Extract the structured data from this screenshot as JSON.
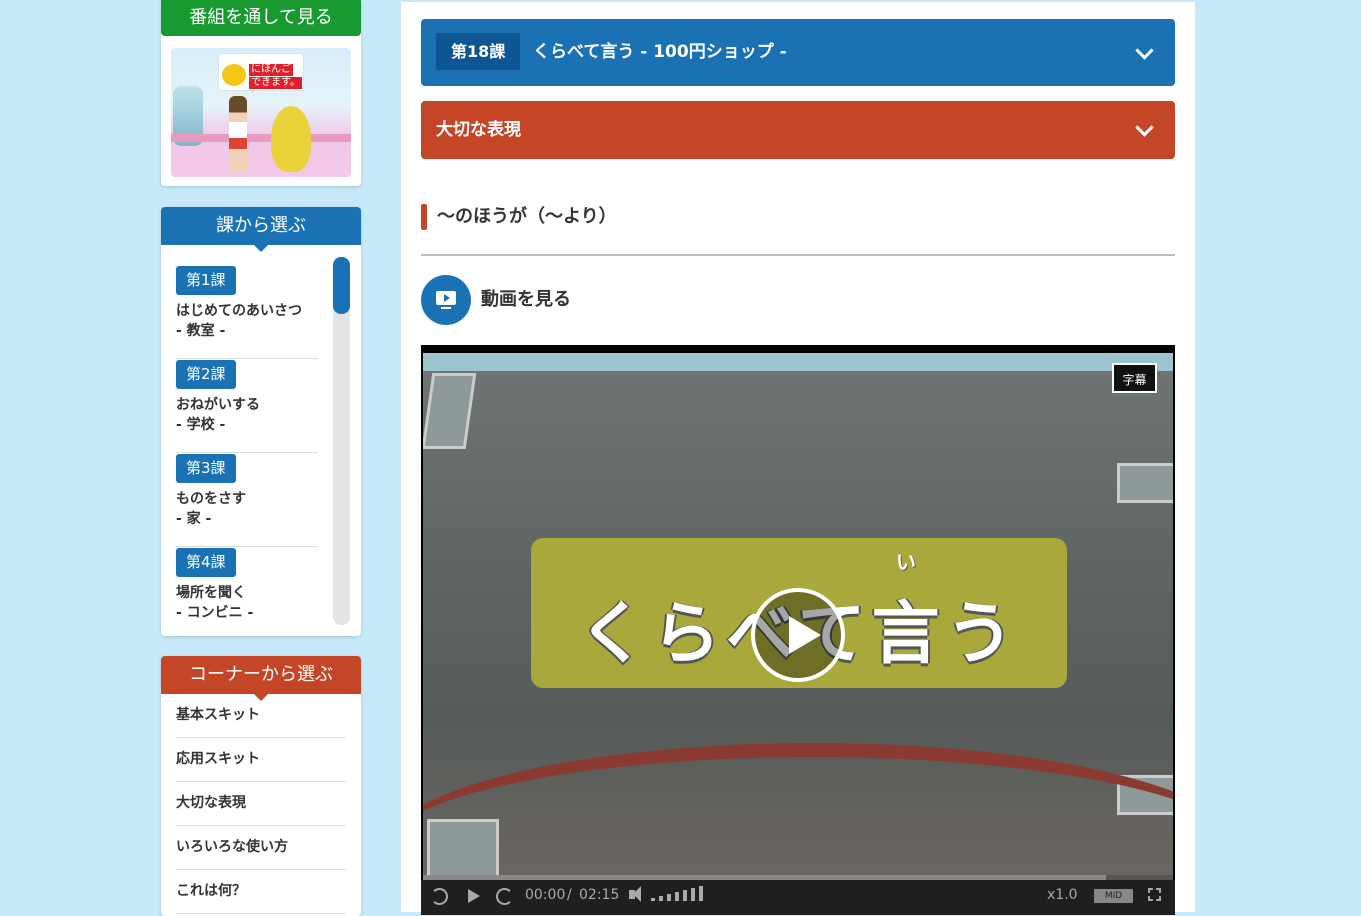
{
  "sidebar": {
    "program": {
      "header": "番組を通して見る",
      "thumbnail": {
        "logo_line1": "にほんご",
        "logo_line2": "できます。"
      }
    },
    "lessons": {
      "header": "課から選ぶ",
      "items": [
        {
          "tag": "第1課",
          "title": "はじめてのあいさつ",
          "place": "- 教室 -"
        },
        {
          "tag": "第2課",
          "title": "おねがいする",
          "place": "- 学校 -"
        },
        {
          "tag": "第3課",
          "title": "ものをさす",
          "place": "- 家 -"
        },
        {
          "tag": "第4課",
          "title": "場所を聞く",
          "place": "- コンビニ -"
        }
      ]
    },
    "corners": {
      "header": "コーナーから選ぶ",
      "items": [
        "基本スキット",
        "応用スキット",
        "大切な表現",
        "いろいろな使い方",
        "これは何？"
      ]
    }
  },
  "main": {
    "lesson_bar": {
      "number": "第18課",
      "title": "くらべて言う - 100円ショップ -"
    },
    "corner_bar": {
      "title": "大切な表現"
    },
    "section_title": "〜のほうが（〜より）",
    "watch_label": "動画を見る",
    "player": {
      "video_title_text": "くらべて言う",
      "video_ruby": "い",
      "caption_button": "字幕",
      "time_current": "00:00",
      "time_separator": "/",
      "time_duration": "02:15",
      "speed": "x1.0",
      "quality": "MID",
      "buffered_fraction": 0.91
    }
  }
}
